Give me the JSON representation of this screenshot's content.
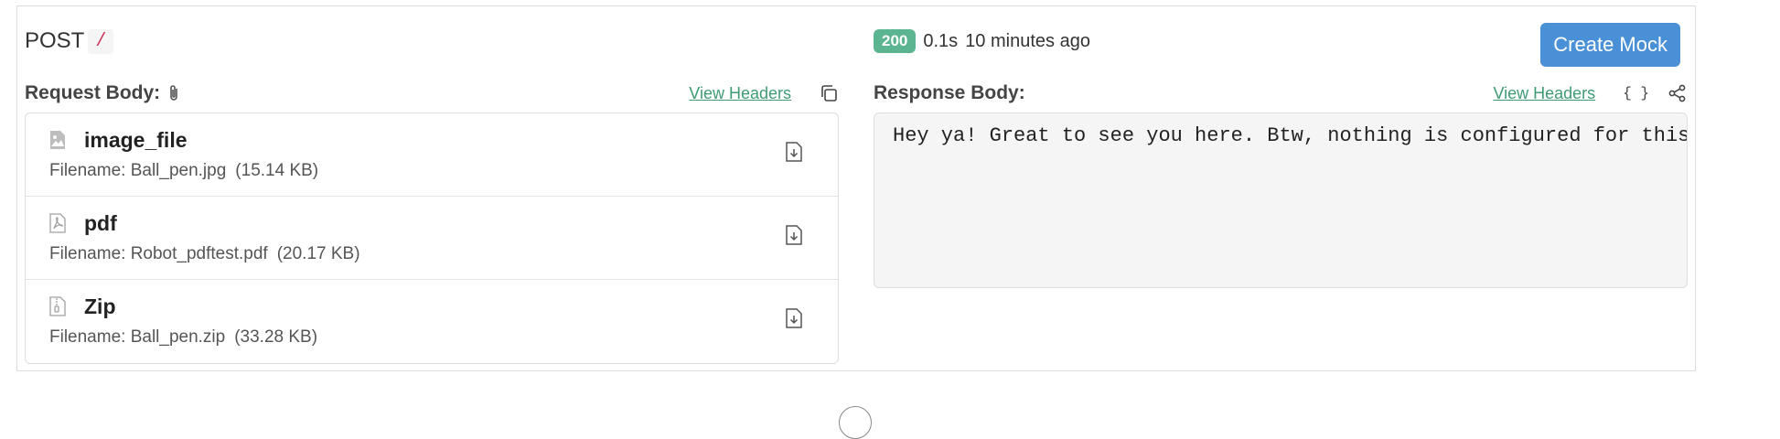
{
  "request": {
    "method": "POST",
    "path": "/"
  },
  "response_status": {
    "code": "200",
    "duration": "0.1s",
    "time_ago": "10 minutes ago"
  },
  "actions": {
    "create_mock_label": "Create Mock"
  },
  "request_body": {
    "title": "Request Body:",
    "view_headers_label": "View Headers",
    "files": [
      {
        "name": "image_file",
        "filename": "Filename: Ball_pen.jpg",
        "size": "(15.14 KB)",
        "icon": "image-file-icon"
      },
      {
        "name": "pdf",
        "filename": "Filename: Robot_pdftest.pdf",
        "size": "(20.17 KB)",
        "icon": "pdf-file-icon"
      },
      {
        "name": "Zip",
        "filename": "Filename: Ball_pen.zip",
        "size": "(33.28 KB)",
        "icon": "zip-file-icon"
      }
    ]
  },
  "response_body": {
    "title": "Response Body:",
    "view_headers_label": "View Headers",
    "format_icon_label": "{ }",
    "content": "Hey ya! Great to see you here. Btw, nothing is configured for this request path. Create a rule and start building a mock API."
  }
}
